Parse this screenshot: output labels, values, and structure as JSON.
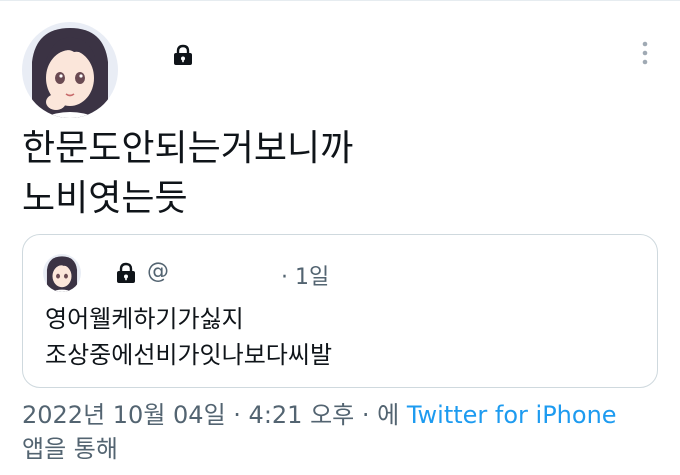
{
  "tweet": {
    "text_line1": "한문도안되는거보니까",
    "text_line2": "노비엿는듯",
    "icons": {
      "lock": "lock-icon",
      "more": "more-vertical-icon"
    }
  },
  "quote": {
    "handle_prefix": "@",
    "time": "· 1일",
    "text_line1": "영어웰케하기가싫지",
    "text_line2": "조상중에선비가잇나보다씨발"
  },
  "meta": {
    "date": "2022년 10월 04일",
    "sep1": " · ",
    "time": "4:21 오후",
    "sep2": " · 에 ",
    "source": "Twitter for iPhone",
    "line2": "앱을 통해"
  },
  "colors": {
    "text": "#0f1419",
    "secondary": "#536471",
    "link": "#1d9bf0",
    "border": "#cfd9de"
  }
}
